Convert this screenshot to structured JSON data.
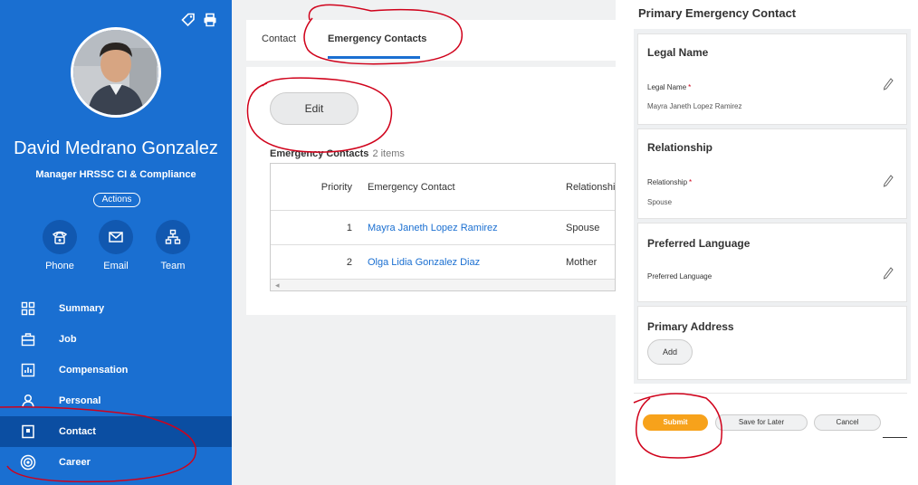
{
  "colors": {
    "sidebar": "#1a6fd1",
    "sidebar_active": "#0b4ea2",
    "link": "#1a6fd1",
    "submit": "#f7a21b",
    "annotation": "#d0021b"
  },
  "sidebar": {
    "tools": [
      {
        "icon": "tag-icon"
      },
      {
        "icon": "print-icon"
      }
    ],
    "avatar_icon": "avatar",
    "name": "David Medrano Gonzalez",
    "job_title": "Manager HRSSC CI & Compliance",
    "actions_label": "Actions",
    "quick_actions": [
      {
        "label": "Phone",
        "icon": "phone-icon"
      },
      {
        "label": "Email",
        "icon": "email-icon"
      },
      {
        "label": "Team",
        "icon": "team-icon"
      }
    ],
    "nav": [
      {
        "label": "Summary",
        "icon": "summary-icon",
        "active": false
      },
      {
        "label": "Job",
        "icon": "job-icon",
        "active": false
      },
      {
        "label": "Compensation",
        "icon": "compensation-icon",
        "active": false
      },
      {
        "label": "Personal",
        "icon": "person-icon",
        "active": false
      },
      {
        "label": "Contact",
        "icon": "contact-icon",
        "active": true
      },
      {
        "label": "Career",
        "icon": "career-icon",
        "active": false
      }
    ]
  },
  "main": {
    "tabs": [
      {
        "label": "Contact",
        "active": false
      },
      {
        "label": "Emergency Contacts",
        "active": true
      }
    ],
    "edit_label": "Edit",
    "table_title": "Emergency Contacts",
    "table_count": "2 items",
    "columns": [
      "Priority",
      "Emergency Contact",
      "Relationship"
    ],
    "rows": [
      {
        "priority": "1",
        "contact": "Mayra Janeth Lopez Ramirez",
        "relationship": "Spouse"
      },
      {
        "priority": "2",
        "contact": "Olga Lidia Gonzalez Diaz",
        "relationship": "Mother"
      }
    ],
    "scroll_arrow": "◂"
  },
  "right": {
    "title": "Primary Emergency Contact",
    "sections": {
      "legal_name": {
        "heading": "Legal Name",
        "label": "Legal Name",
        "required": "*",
        "value": "Mayra Janeth Lopez Ramirez"
      },
      "relationship": {
        "heading": "Relationship",
        "label": "Relationship",
        "required": "*",
        "value": "Spouse"
      },
      "language": {
        "heading": "Preferred Language",
        "label": "Preferred Language"
      },
      "address": {
        "heading": "Primary Address",
        "add_label": "Add"
      }
    },
    "footer": {
      "submit": "Submit",
      "save_later": "Save for Later",
      "cancel": "Cancel"
    }
  }
}
